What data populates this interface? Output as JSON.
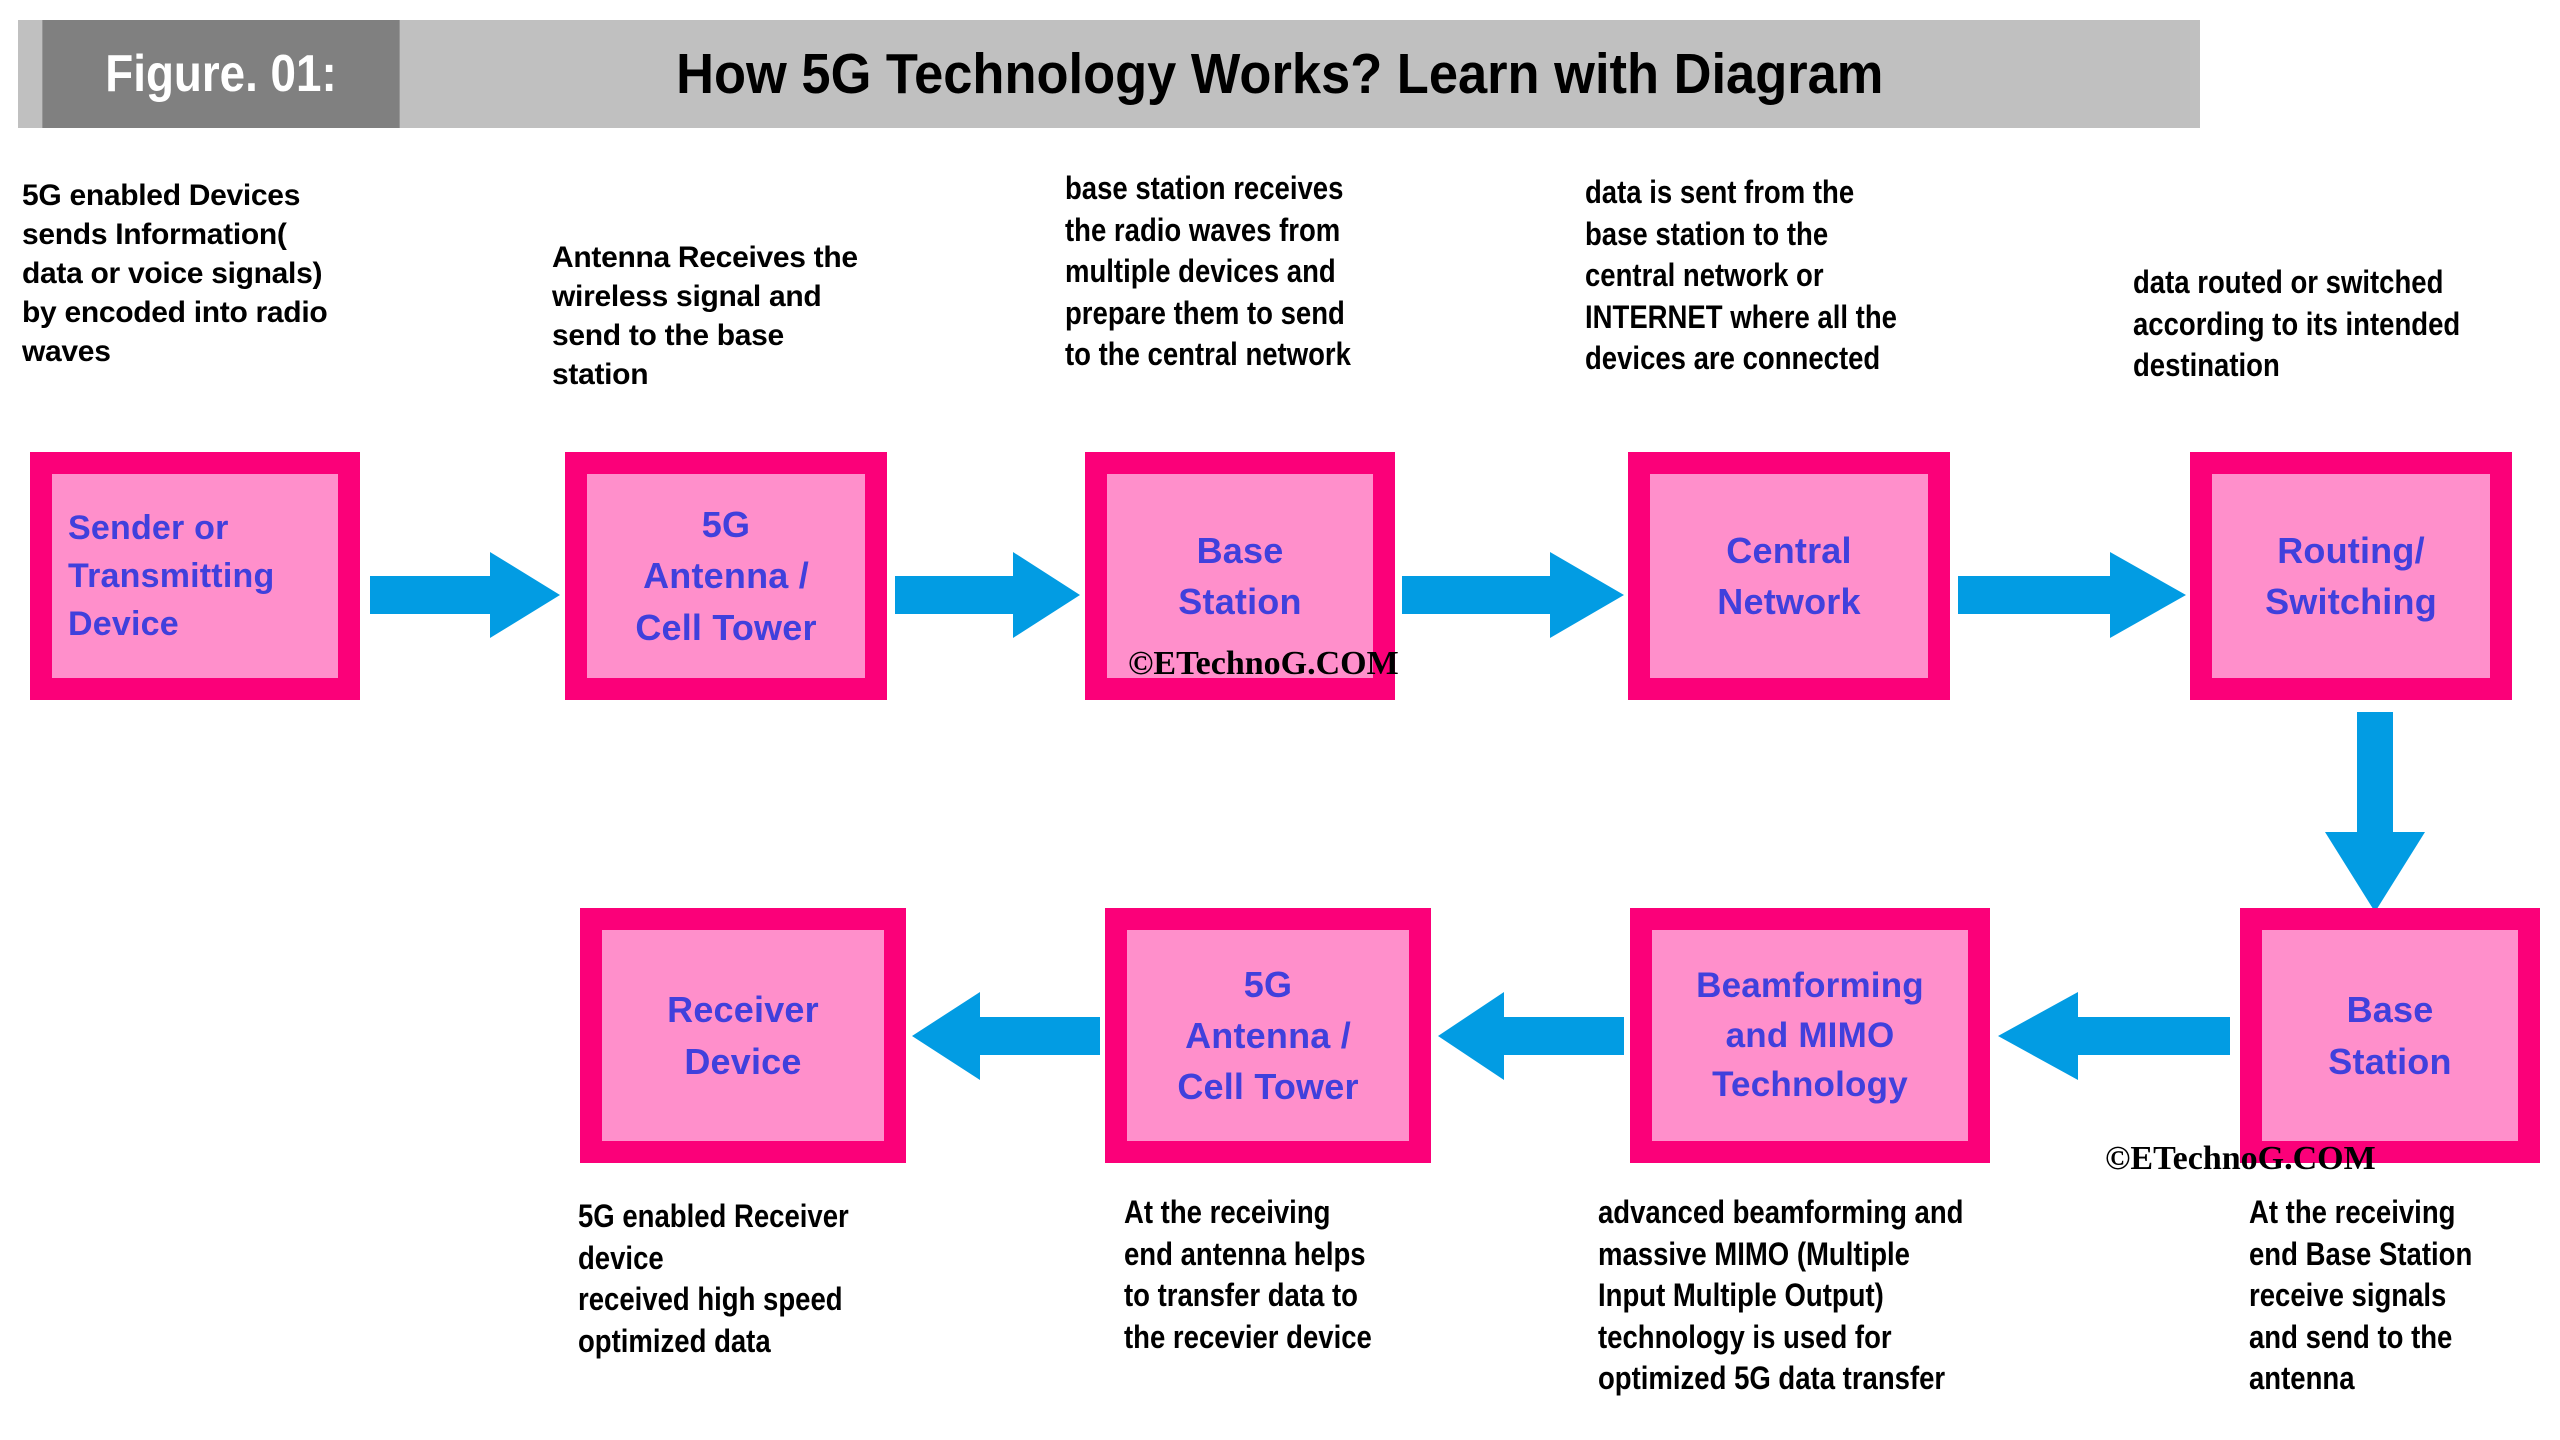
{
  "header": {
    "figure_label": "Figure. 01:",
    "title": "How 5G Technology Works? Learn with Diagram",
    "tag_bg": "#808080",
    "bar_bg": "#c0c0c0"
  },
  "theme": {
    "box_border_color": "#fb0079",
    "box_fill_color": "#ff8fcb",
    "box_text_color": "#4040dc",
    "arrow_color": "#029ce3",
    "note_text_color": "#000000",
    "page_bg": "#ffffff"
  },
  "notes": {
    "n1": "5G enabled Devices\nsends Information(\ndata or voice signals)\nby encoded into radio\nwaves",
    "n2": "Antenna Receives the\nwireless signal and\nsend to the base\nstation",
    "n3": "base station receives\nthe radio waves from\nmultiple devices and\nprepare them to send\nto the central network",
    "n4": "data is sent from the\nbase station to the\ncentral network or\nINTERNET where all the\ndevices are connected",
    "n5": "data routed or switched\naccording to its intended\ndestination",
    "n6": "5G enabled Receiver\ndevice\nreceived high speed\noptimized data",
    "n7": "At the receiving\nend antenna helps\nto transfer data to\nthe recevier device",
    "n8": "advanced beamforming and\nmassive MIMO (Multiple\nInput Multiple Output)\ntechnology is used for\noptimized 5G data transfer",
    "n9": "At the receiving\nend Base Station\nreceive signals\nand send to the\nantenna"
  },
  "boxes": {
    "b1": "Sender or\nTransmitting\nDevice",
    "b2": "5G\nAntenna /\nCell Tower",
    "b3": "Base\nStation",
    "b4": "Central\nNetwork",
    "b5": "Routing/\nSwitching",
    "b6": "Base\nStation",
    "b7": "Beamforming\nand  MIMO\nTechnology",
    "b8": "5G\nAntenna /\nCell Tower",
    "b9": "Receiver\nDevice"
  },
  "watermarks": {
    "w1": "©ETechnoG.COM",
    "w2": "©ETechnoG.COM"
  },
  "flow": {
    "arrows": [
      {
        "name": "arrow-sender-to-antenna",
        "direction": "right"
      },
      {
        "name": "arrow-antenna-to-base",
        "direction": "right"
      },
      {
        "name": "arrow-base-to-central",
        "direction": "right"
      },
      {
        "name": "arrow-central-to-routing",
        "direction": "right"
      },
      {
        "name": "arrow-routing-to-base2",
        "direction": "down"
      },
      {
        "name": "arrow-base2-to-beamforming",
        "direction": "left"
      },
      {
        "name": "arrow-beamforming-to-antenna2",
        "direction": "left"
      },
      {
        "name": "arrow-antenna2-to-receiver",
        "direction": "left"
      }
    ]
  }
}
